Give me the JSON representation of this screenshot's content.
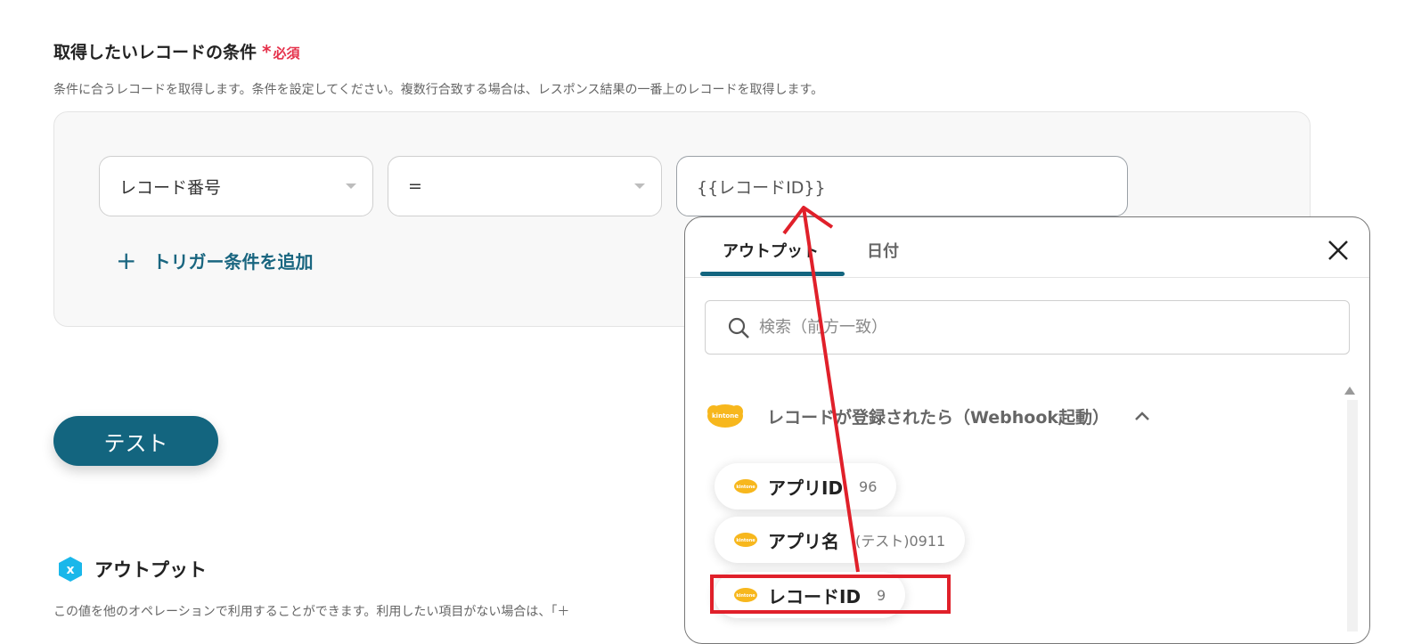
{
  "section": {
    "title": "取得したいレコードの条件",
    "required_star": "*",
    "required_label": "必須",
    "description": "条件に合うレコードを取得します。条件を設定してください。複数行合致する場合は、レスポンス結果の一番上のレコードを取得します。"
  },
  "condition": {
    "field_select": "レコード番号",
    "operator_select": "=",
    "value": "{{レコードID}}"
  },
  "add_trigger_label": "トリガー条件を追加",
  "test_button": "テスト",
  "output": {
    "heading": "アウトプット",
    "description": "この値を他のオペレーションで利用することができます。利用したい項目がない場合は、「＋"
  },
  "popup": {
    "tabs": [
      "アウトプット",
      "日付"
    ],
    "search_placeholder": "検索（前方一致）",
    "group_title": "レコードが登録されたら（Webhook起動）",
    "items": [
      {
        "name": "アプリID",
        "value": "96"
      },
      {
        "name": "アプリ名",
        "value": "(テスト)0911"
      },
      {
        "name": "レコードID",
        "value": "9"
      }
    ]
  },
  "icons": {
    "plus": "plus-icon",
    "close": "close-icon",
    "search": "search-icon",
    "chevron": "chevron-up-icon",
    "logo": "kintone-logo",
    "output_badge": "x-badge-icon"
  },
  "colors": {
    "accent": "#13657f",
    "required": "#e5304a",
    "annotation": "#e0202a",
    "kintone": "#f7b71d"
  }
}
